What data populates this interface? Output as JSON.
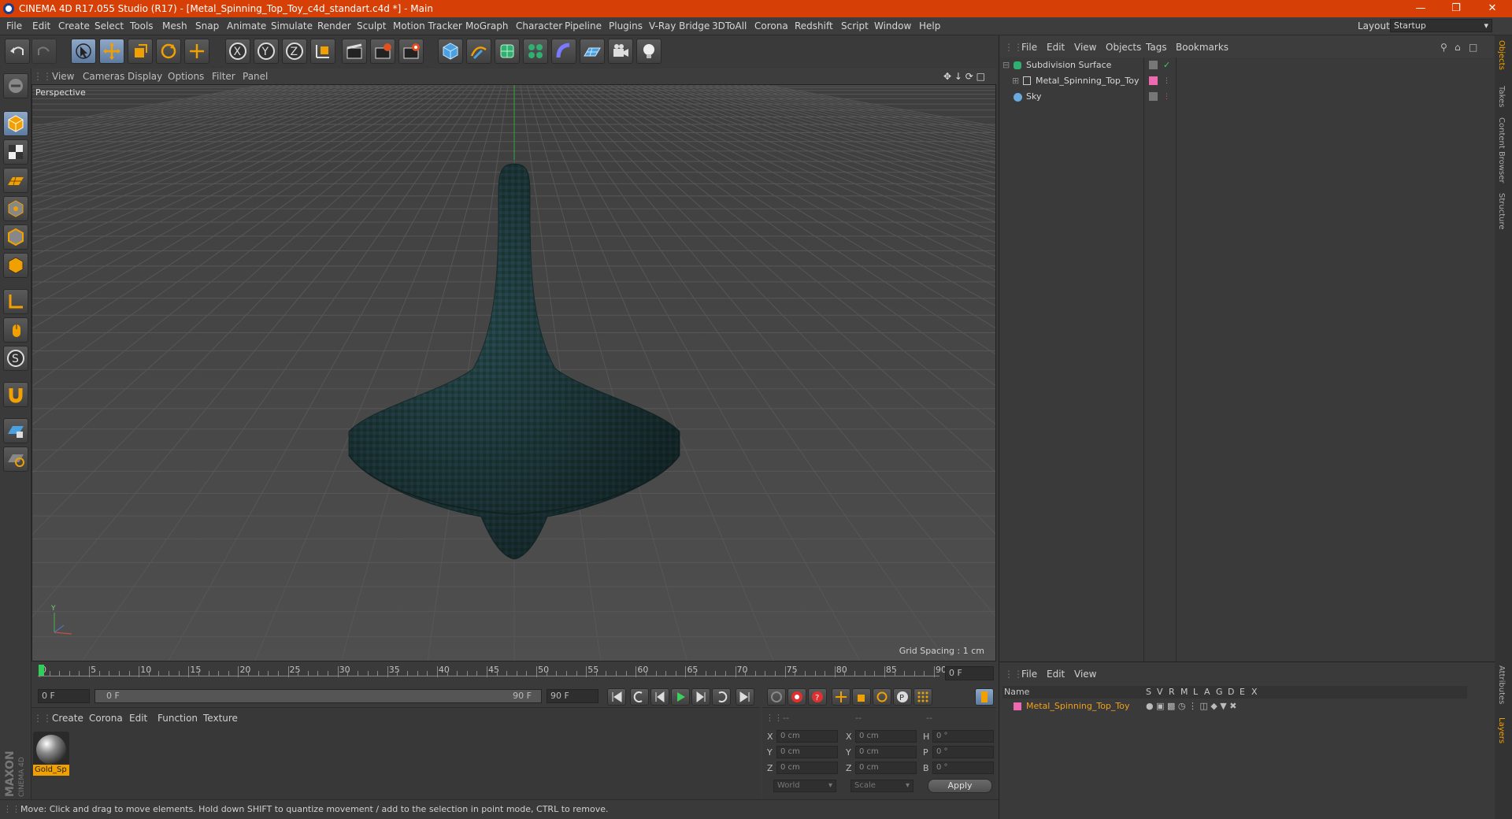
{
  "window": {
    "title": "CINEMA 4D R17.055 Studio (R17) - [Metal_Spinning_Top_Toy_c4d_standart.c4d *] - Main",
    "layout_label": "Layout:",
    "layout_value": "Startup"
  },
  "menu": [
    "File",
    "Edit",
    "Create",
    "Select",
    "Tools",
    "Mesh",
    "Snap",
    "Animate",
    "Simulate",
    "Render",
    "Sculpt",
    "Motion Tracker",
    "MoGraph",
    "Character",
    "Pipeline",
    "Plugins",
    "V-Ray Bridge",
    "3DToAll",
    "Corona",
    "Redshift",
    "Script",
    "Window",
    "Help"
  ],
  "viewport": {
    "menu": [
      "View",
      "Cameras",
      "Display",
      "Options",
      "Filter",
      "Panel"
    ],
    "label": "Perspective",
    "grid_spacing": "Grid Spacing : 1 cm"
  },
  "timeline": {
    "ticks": [
      "0",
      "5",
      "10",
      "15",
      "20",
      "25",
      "30",
      "35",
      "40",
      "45",
      "50",
      "55",
      "60",
      "65",
      "70",
      "75",
      "80",
      "85",
      "90"
    ],
    "current_frame": "0 F",
    "start_frame": "0 F",
    "range_start": "0 F",
    "range_end": "90 F",
    "end_frame": "90 F"
  },
  "material_panel": {
    "menu": [
      "Create",
      "Corona",
      "Edit",
      "Function",
      "Texture"
    ],
    "material_name": "Gold_Sp"
  },
  "coords": {
    "headers": [
      "--",
      "--",
      "--"
    ],
    "rows": [
      {
        "a": "X",
        "av": "0 cm",
        "b": "X",
        "bv": "0 cm",
        "c": "H",
        "cv": "0 °"
      },
      {
        "a": "Y",
        "av": "0 cm",
        "b": "Y",
        "bv": "0 cm",
        "c": "P",
        "cv": "0 °"
      },
      {
        "a": "Z",
        "av": "0 cm",
        "b": "Z",
        "bv": "0 cm",
        "c": "B",
        "cv": "0 °"
      }
    ],
    "mode1": "World",
    "mode2": "Scale",
    "apply": "Apply"
  },
  "status": "Move: Click and drag to move elements. Hold down SHIFT to quantize movement / add to the selection in point mode, CTRL to remove.",
  "objects_panel": {
    "menu": [
      "File",
      "Edit",
      "View",
      "Objects",
      "Tags",
      "Bookmarks"
    ],
    "items": [
      "Subdivision Surface",
      "Metal_Spinning_Top_Toy",
      "Sky"
    ]
  },
  "attributes_panel": {
    "menu": [
      "File",
      "Edit",
      "View"
    ],
    "columns": [
      "Name",
      "S",
      "V",
      "R",
      "M",
      "L",
      "A",
      "G",
      "D",
      "E",
      "X"
    ],
    "row_name": "Metal_Spinning_Top_Toy"
  },
  "side_tabs": [
    "Objects",
    "Takes",
    "Content Browser",
    "Structure",
    "Attributes",
    "Layers"
  ],
  "brand": {
    "maxon": "MAXON",
    "product": "CINEMA 4D"
  },
  "colors": {
    "title_bar": "#d63f05",
    "accent_orange": "#f0a000",
    "selection_blue": "#6a8cb8"
  }
}
